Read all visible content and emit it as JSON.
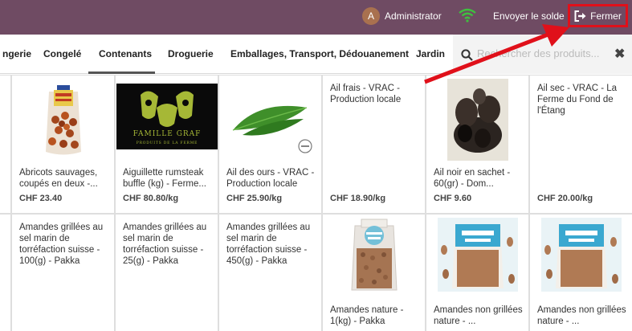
{
  "topbar": {
    "user_initial": "A",
    "user_name": "Administrator",
    "send_balance": "Envoyer le solde",
    "close_label": "Fermer"
  },
  "categories": [
    "ngerie",
    "Congelé",
    "Contenants",
    "Droguerie",
    "Emballages, Transport, Dédouanement",
    "Jardin"
  ],
  "active_category": "Contenants",
  "search": {
    "placeholder": "Rechercher des produits..."
  },
  "products": [
    {
      "name": "Abricots sauvages, coupés en deux -...",
      "price": "CHF 23.40"
    },
    {
      "name": "Aiguillette rumsteak buffle (kg) - Ferme...",
      "price": "CHF 80.80/kg",
      "logo_text": "FAMILLE GRAF",
      "logo_sub": "PRODUITS DE LA FERME"
    },
    {
      "name": "Ail des ours - VRAC - Production locale",
      "price": "CHF 25.90/kg"
    },
    {
      "name": "Ail frais - VRAC - Production locale",
      "price": "CHF 18.90/kg"
    },
    {
      "name": "Ail noir en sachet - 60(gr) - Dom...",
      "price": "CHF 9.60"
    },
    {
      "name": "Ail sec - VRAC - La Ferme du Fond de l'Étang",
      "price": "CHF 20.00/kg"
    },
    {
      "name": "Amandes grillées au sel marin de torréfaction suisse - 100(g) - Pakka",
      "price": ""
    },
    {
      "name": "Amandes grillées au sel marin de torréfaction suisse - 25(g) - Pakka",
      "price": ""
    },
    {
      "name": "Amandes grillées au sel marin de torréfaction suisse - 450(g) - Pakka",
      "price": ""
    },
    {
      "name": "Amandes nature - 1(kg) - Pakka",
      "price": ""
    },
    {
      "name": "Amandes non grillées nature - ...",
      "price": ""
    },
    {
      "name": "Amandes non grillées nature - ...",
      "price": ""
    }
  ],
  "colors": {
    "topbar": "#6f4b63",
    "highlight": "#e0101a",
    "wifi": "#3fbf3f"
  }
}
